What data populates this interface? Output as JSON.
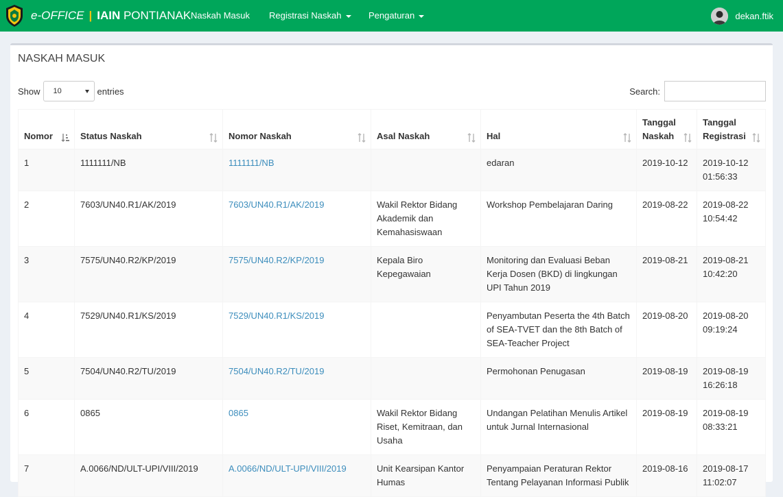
{
  "navbar": {
    "brand_prefix": "e-OFFICE",
    "brand_separator": "|",
    "brand_institution_bold": "IAIN",
    "brand_institution": "PONTIANAK",
    "menu": [
      {
        "label": "Naskah Masuk"
      },
      {
        "label": "Registrasi Naskah"
      },
      {
        "label": "Pengaturan"
      }
    ],
    "user_name": "dekan.ftik",
    "colors": {
      "navbar": "#00a65a",
      "link": "#3c8dbc"
    }
  },
  "page": {
    "title": "NASKAH MASUK",
    "show_label": "Show",
    "entries_value": "10",
    "entries_label": "entries",
    "search_label": "Search:",
    "search_value": ""
  },
  "table": {
    "headers": [
      "Nomor",
      "Status Naskah",
      "Nomor Naskah",
      "Asal Naskah",
      "Hal",
      "Tanggal Naskah",
      "Tanggal Registrasi"
    ],
    "rows": [
      {
        "nomor": "1",
        "status": "1111111/NB",
        "nomor_naskah": "1111111/NB",
        "asal": "",
        "hal": "edaran",
        "tgl_naskah": "2019-10-12",
        "tgl_reg": "2019-10-12 01:56:33"
      },
      {
        "nomor": "2",
        "status": "7603/UN40.R1/AK/2019",
        "nomor_naskah": "7603/UN40.R1/AK/2019",
        "asal": "Wakil Rektor Bidang Akademik dan Kemahasiswaan",
        "hal": "Workshop Pembelajaran Daring",
        "tgl_naskah": "2019-08-22",
        "tgl_reg": "2019-08-22 10:54:42"
      },
      {
        "nomor": "3",
        "status": "7575/UN40.R2/KP/2019",
        "nomor_naskah": "7575/UN40.R2/KP/2019",
        "asal": "Kepala Biro Kepegawaian",
        "hal": "Monitoring dan Evaluasi Beban Kerja Dosen (BKD) di lingkungan UPI Tahun 2019",
        "tgl_naskah": "2019-08-21",
        "tgl_reg": "2019-08-21 10:42:20"
      },
      {
        "nomor": "4",
        "status": "7529/UN40.R1/KS/2019",
        "nomor_naskah": "7529/UN40.R1/KS/2019",
        "asal": "",
        "hal": "Penyambutan Peserta the 4th Batch of SEA-TVET dan the 8th Batch of SEA-Teacher Project",
        "tgl_naskah": "2019-08-20",
        "tgl_reg": "2019-08-20 09:19:24"
      },
      {
        "nomor": "5",
        "status": "7504/UN40.R2/TU/2019",
        "nomor_naskah": "7504/UN40.R2/TU/2019",
        "asal": "",
        "hal": "Permohonan Penugasan",
        "tgl_naskah": "2019-08-19",
        "tgl_reg": "2019-08-19 16:26:18"
      },
      {
        "nomor": "6",
        "status": "0865",
        "nomor_naskah": "0865",
        "asal": "Wakil Rektor Bidang Riset, Kemitraan, dan Usaha",
        "hal": "Undangan Pelatihan Menulis Artikel untuk Jurnal Internasional",
        "tgl_naskah": "2019-08-19",
        "tgl_reg": "2019-08-19 08:33:21"
      },
      {
        "nomor": "7",
        "status": "A.0066/ND/ULT-UPI/VIII/2019",
        "nomor_naskah": "A.0066/ND/ULT-UPI/VIII/2019",
        "asal": "Unit Kearsipan Kantor Humas",
        "hal": "Penyampaian Peraturan Rektor Tentang Pelayanan Informasi Publik",
        "tgl_naskah": "2019-08-16",
        "tgl_reg": "2019-08-17 11:02:07"
      }
    ]
  }
}
